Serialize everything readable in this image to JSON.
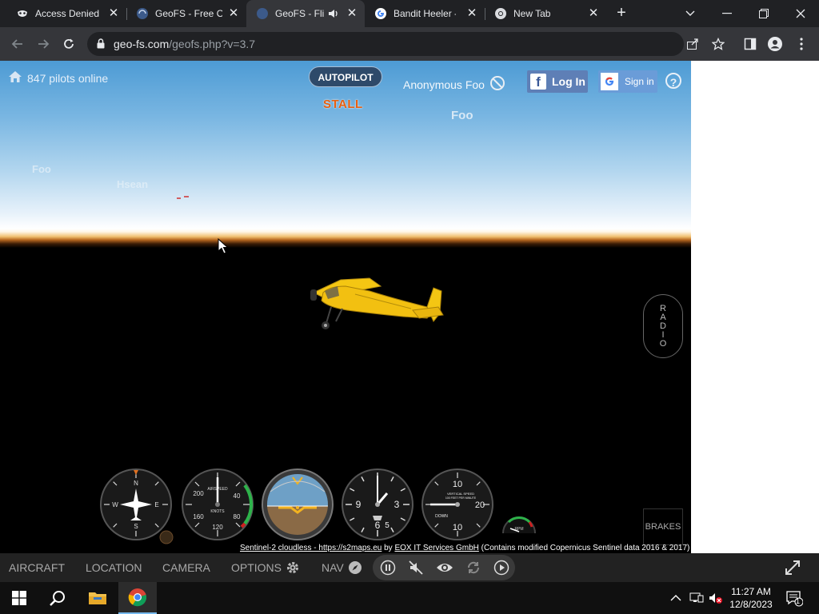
{
  "browser": {
    "tabs": [
      {
        "title": "Access Denied",
        "favicon": "masked-icon"
      },
      {
        "title": "GeoFS - Free O",
        "favicon": "geofs-globe-icon"
      },
      {
        "title": "GeoFS - Fli",
        "favicon": "geofs-globe-icon",
        "active": true,
        "audio": true
      },
      {
        "title": "Bandit Heeler -",
        "favicon": "google-g-icon"
      },
      {
        "title": "New Tab",
        "favicon": "chrome-icon"
      }
    ],
    "url_host": "geo-fs.com",
    "url_path": "/geofs.php?v=3.7"
  },
  "game": {
    "pilots_online": "847 pilots online",
    "autopilot_label": "AUTOPILOT",
    "stall_label": "STALL",
    "user_name": "Anonymous Foo",
    "facebook_login": "Log In",
    "google_signin": "Sign in",
    "help_symbol": "?",
    "nametags": [
      "Foo",
      "Foo",
      "Hsean"
    ],
    "radio_letters": [
      "R",
      "A",
      "D",
      "I",
      "O"
    ],
    "brakes_label": "BRAKES",
    "credit": {
      "source_text": "Sentinel-2 cloudless - https://s2maps.eu",
      "by": "by",
      "provider": "EOX IT Services GmbH",
      "note": "(Contains modified Copernicus Sentinel data 2016 & 2017)"
    },
    "instruments": {
      "airspeed_title": "AIRSPEED",
      "airspeed_unit": "KNOTS",
      "airspeed_ticks": [
        "200",
        "40",
        "160",
        "80",
        "120"
      ],
      "clock_ticks": [
        "9",
        "3",
        "6",
        "5"
      ],
      "vsi_title": "VERTICAL SPEED",
      "vsi_sub": "100 FEET PER MINUTE",
      "vsi_ticks": [
        "10",
        "20",
        "10"
      ],
      "vsi_down": "DOWN",
      "rpm_label": "RPM",
      "heading_ticks": [
        "N",
        "3",
        "6",
        "E",
        "12",
        "15",
        "S",
        "21",
        "24",
        "W",
        "30",
        "33"
      ]
    }
  },
  "menu": {
    "items": [
      "AIRCRAFT",
      "LOCATION",
      "CAMERA",
      "OPTIONS",
      "NAV"
    ]
  },
  "taskbar": {
    "time": "11:27 AM",
    "date": "12/8/2023",
    "notifications": "1"
  },
  "colors": {
    "stall": "#e85f10",
    "autopilot_bg": "#2e4a6a",
    "facebook": "#5e7fb6",
    "google": "#6a9cd8"
  }
}
